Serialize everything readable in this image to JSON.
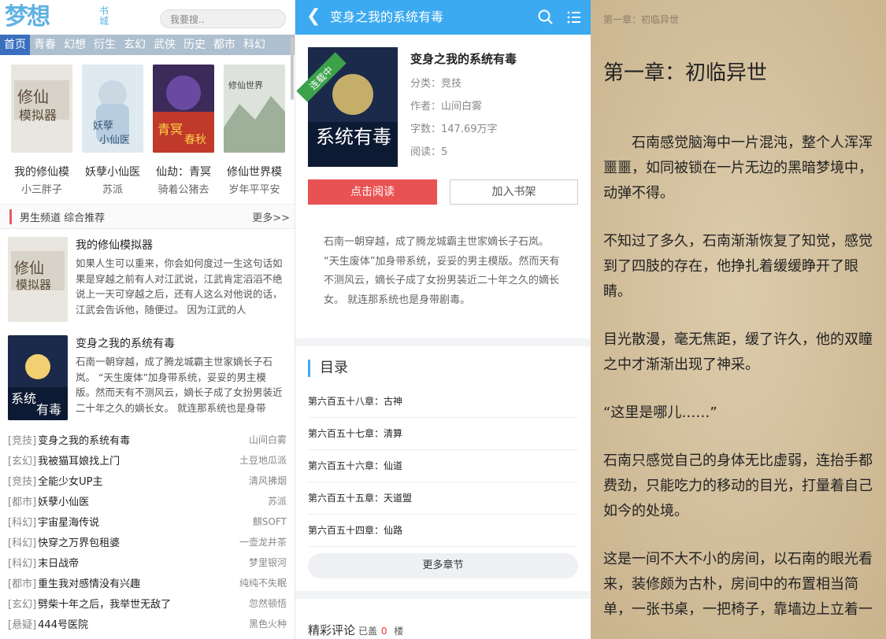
{
  "left": {
    "logo_big": "梦想",
    "logo_small": "书城",
    "search_placeholder": "我要搜..",
    "nav": [
      "首页",
      "青春",
      "幻想",
      "衍生",
      "玄幻",
      "武侠",
      "历史",
      "都市",
      "科幻"
    ],
    "hot_books": [
      {
        "title": "我的修仙模",
        "author": "小三胖子"
      },
      {
        "title": "妖孽小仙医",
        "author": "苏派"
      },
      {
        "title": "仙劫：青冥",
        "author": "骑着公猪去"
      },
      {
        "title": "修仙世界模",
        "author": "岁年平平安"
      }
    ],
    "section_title": "男生频道 综合推荐",
    "section_more": "更多>>",
    "recommend": [
      {
        "title": "我的修仙模拟器",
        "desc": "如果人生可以重来，你会如何度过一生这句话如果是穿越之前有人对江武说，江武肯定滔滔不绝说上一天可穿越之后，还有人这么对他说的话，江武会告诉他，随便过。 因为江武的人"
      },
      {
        "title": "变身之我的系统有毒",
        "desc": "石南一朝穿越，成了腾龙城霸主世家嫡长子石岚。 “天生废体”加身带系统，妥妥的男主模版。然而天有不测风云，嫡长子成了女扮男装近二十年之久的嫡长女。 就连那系统也是身带"
      }
    ],
    "list": [
      {
        "cat": "[竞技]",
        "name": "变身之我的系统有毒",
        "author": "山间白雾"
      },
      {
        "cat": "[玄幻]",
        "name": "我被猫耳娘找上门",
        "author": "土豆地瓜派"
      },
      {
        "cat": "[竞技]",
        "name": "全能少女UP主",
        "author": "清风拂烟"
      },
      {
        "cat": "[都市]",
        "name": "妖孽小仙医",
        "author": "苏派"
      },
      {
        "cat": "[科幻]",
        "name": "宇宙星海传说",
        "author": "麒SOFT"
      },
      {
        "cat": "[科幻]",
        "name": "快穿之万界包租婆",
        "author": "一壶龙井茶"
      },
      {
        "cat": "[科幻]",
        "name": "末日战帝",
        "author": "梦里银河"
      },
      {
        "cat": "[都市]",
        "name": "重生我对感情没有兴趣",
        "author": "纯纯不失眠"
      },
      {
        "cat": "[玄幻]",
        "name": "劈柴十年之后，我举世无敌了",
        "author": "忽然顿悟"
      },
      {
        "cat": "[悬疑]",
        "name": "444号医院",
        "author": "黑色火种"
      }
    ]
  },
  "mid": {
    "header_title": "变身之我的系统有毒",
    "ribbon": "连载中",
    "book_title": "变身之我的系统有毒",
    "category": "分类：竞技",
    "author": "作者：山间白雾",
    "words": "字数：147.69万字",
    "reads": "阅读：5",
    "read_button": "点击阅读",
    "shelf_button": "加入书架",
    "description": "石南一朝穿越，成了腾龙城霸主世家嫡长子石岚。 “天生废体”加身带系统，妥妥的男主模版。然而天有不测风云，嫡长子成了女扮男装近二十年之久的嫡长女。 就连那系统也是身带剧毒。",
    "toc_title": "目录",
    "chapters": [
      "第六百五十八章：古神",
      "第六百五十七章：清算",
      "第六百五十六章：仙道",
      "第六百五十五章：天道盟",
      "第六百五十四章：仙路"
    ],
    "more_chapters": "更多章节",
    "comments_title": "精彩评论",
    "comments_prefix": "已盖",
    "comments_count": "0",
    "comments_suffix": "楼"
  },
  "right": {
    "top_label": "第一章：初临异世",
    "chapter_title": "第一章：初临异世",
    "paragraphs": [
      "　　石南感觉脑海中一片混沌，整个人浑浑噩噩，如同被锁在一片无边的黑暗梦境中，动弹不得。",
      "不知过了多久，石南渐渐恢复了知觉，感觉到了四肢的存在，他挣扎着缓缓睁开了眼睛。",
      "目光散漫，毫无焦距，缓了许久，他的双瞳之中才渐渐出现了神采。",
      "“这里是哪儿……”",
      "石南只感觉自己的身体无比虚弱，连抬手都费劲，只能吃力的移动的目光，打量着自己如今的处境。",
      "这是一间不大不小的房间，以石南的眼光看来，装修颇为古朴，房间中的布置相当简单，一张书桌，一把椅子，靠墙边上立着一"
    ]
  }
}
